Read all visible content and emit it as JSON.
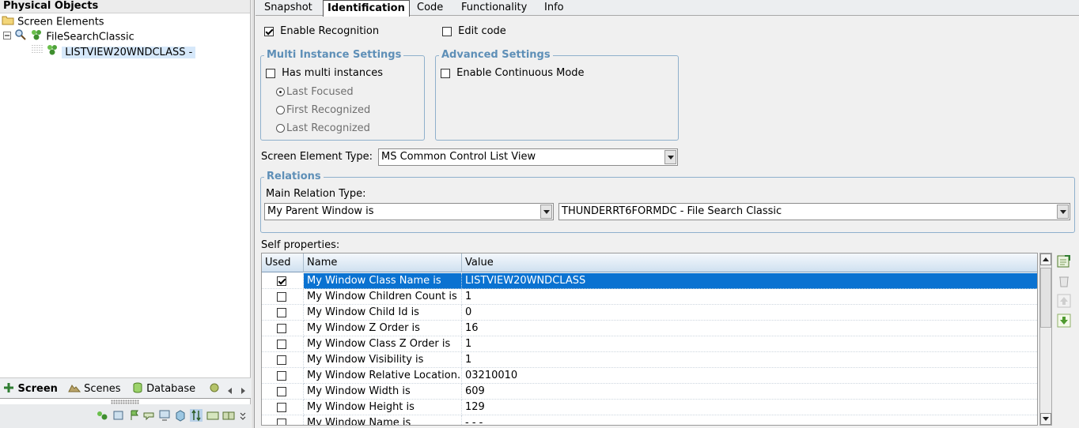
{
  "left": {
    "title": "Physical Objects",
    "tree": {
      "root": "Screen Elements",
      "app": "FileSearchClassic",
      "element": "LISTVIEW20WNDCLASS -"
    },
    "tabs": {
      "screen": "Screen",
      "scenes": "Scenes",
      "database": "Database"
    }
  },
  "tabs": [
    "Snapshot",
    "Identification",
    "Code",
    "Functionality",
    "Info"
  ],
  "identification": {
    "enable_recognition": {
      "label": "Enable Recognition",
      "checked": true
    },
    "edit_code": {
      "label": "Edit code",
      "checked": false
    },
    "multi": {
      "title": "Multi Instance Settings",
      "has_multi": "Has multi instances",
      "last_focused": "Last Focused",
      "first_recognized": "First Recognized",
      "last_recognized": "Last Recognized"
    },
    "advanced": {
      "title": "Advanced Settings",
      "continuous": "Enable Continuous Mode"
    },
    "element_type_label": "Screen Element Type:",
    "element_type_value": "MS Common Control List View",
    "relations": {
      "title": "Relations",
      "main_label": "Main Relation Type:",
      "relation_value": "My Parent Window is",
      "target_value": "THUNDERRT6FORMDC - File Search Classic"
    },
    "self_properties_label": "Self properties:",
    "columns": {
      "used": "Used",
      "name": "Name",
      "value": "Value"
    },
    "rows": [
      {
        "used": true,
        "name": "My Window Class Name is",
        "value": "LISTVIEW20WNDCLASS"
      },
      {
        "used": false,
        "name": "My Window Children Count is",
        "value": "1"
      },
      {
        "used": false,
        "name": "My Window Child Id is",
        "value": "0"
      },
      {
        "used": false,
        "name": "My Window Z Order is",
        "value": "16"
      },
      {
        "used": false,
        "name": "My Window Class Z Order is",
        "value": "1"
      },
      {
        "used": false,
        "name": "My Window Visibility is",
        "value": "1"
      },
      {
        "used": false,
        "name": "My Window Relative Location...",
        "value": "03210010"
      },
      {
        "used": false,
        "name": "My Window Width is",
        "value": "609"
      },
      {
        "used": false,
        "name": "My Window Height is",
        "value": "129"
      },
      {
        "used": false,
        "name": "My Window Name is",
        "value": "- - -"
      }
    ]
  },
  "colors": {
    "selection": "#0a72d1",
    "group_title": "#5e8fb7",
    "group_border": "#8fb0cc"
  }
}
